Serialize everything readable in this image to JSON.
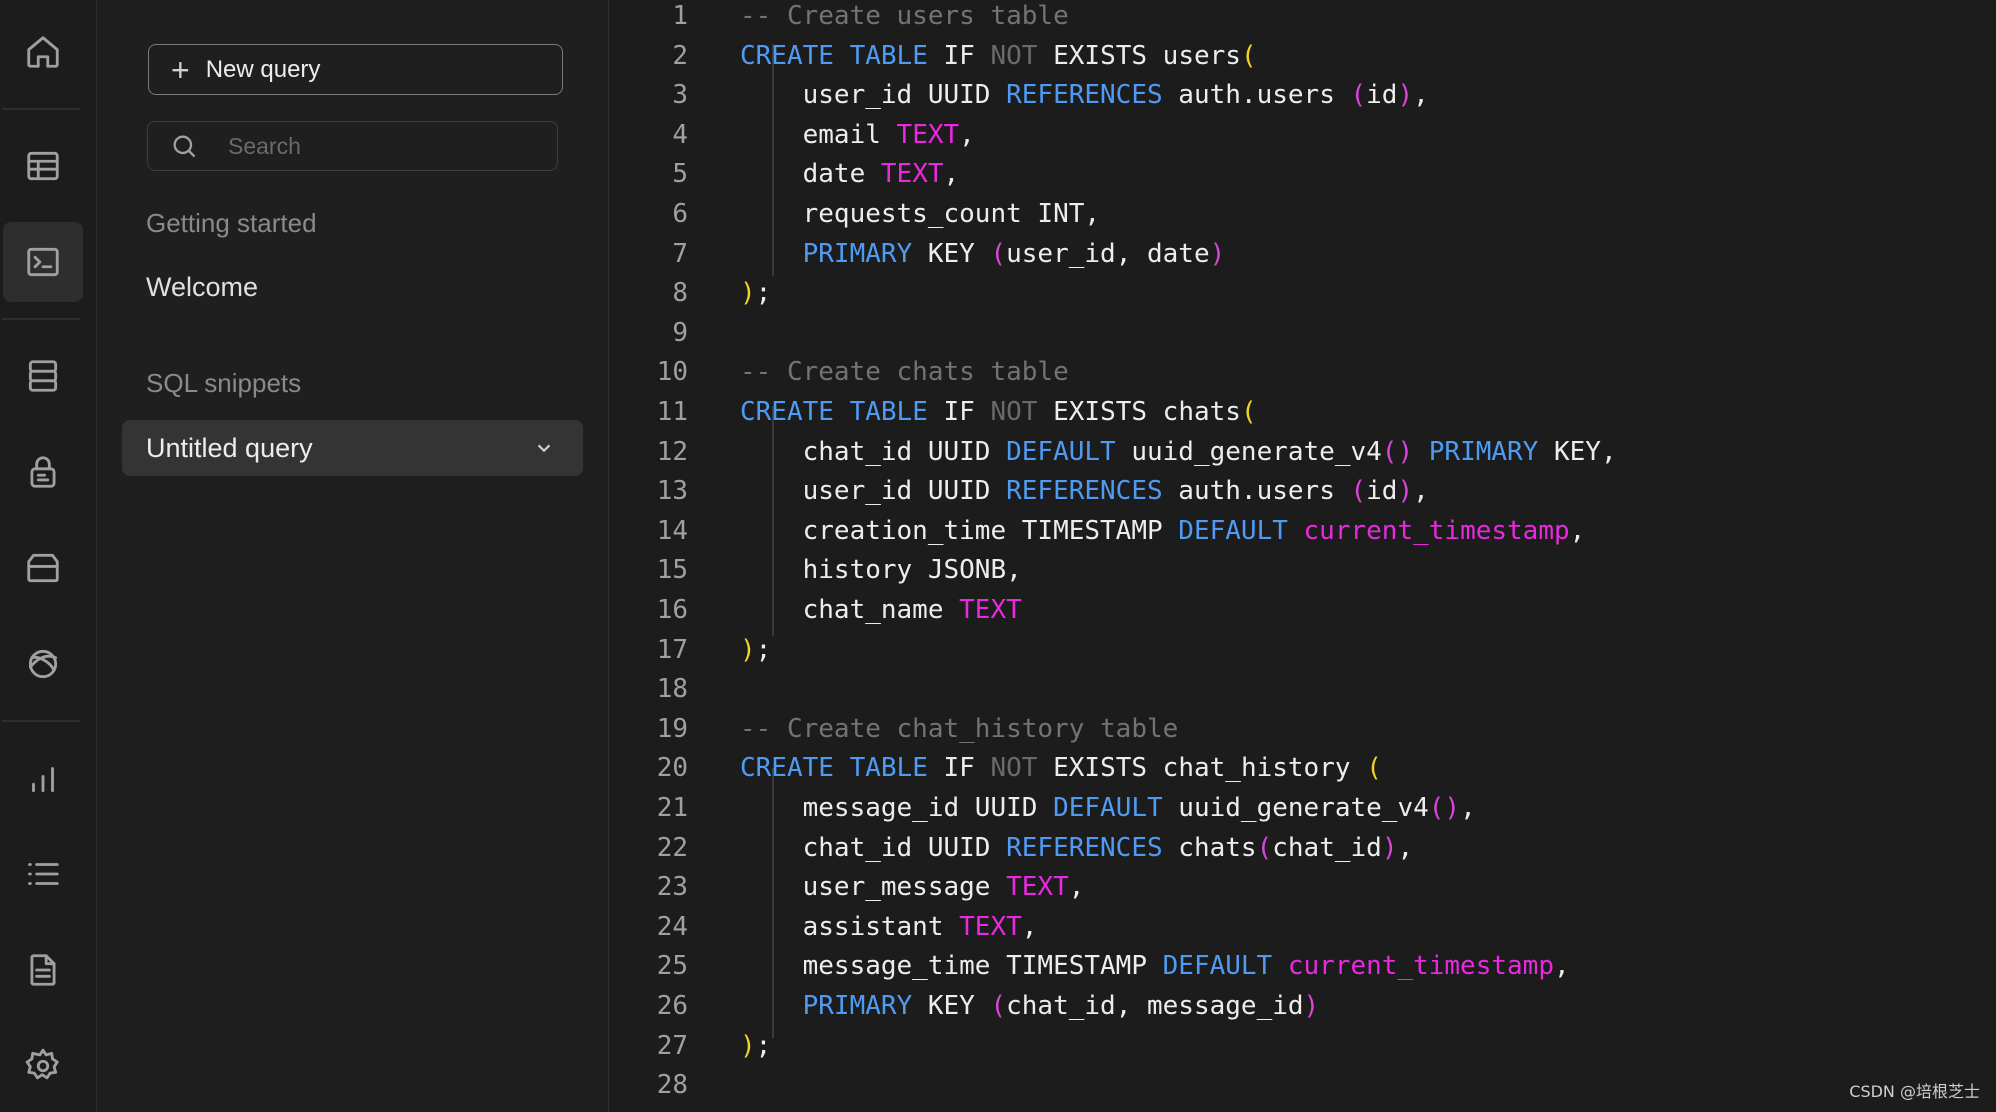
{
  "rail": {
    "items": [
      {
        "name": "home-icon"
      },
      {
        "name": "table-editor-icon"
      },
      {
        "name": "sql-editor-icon",
        "active": true
      },
      {
        "name": "database-icon"
      },
      {
        "name": "auth-lock-icon"
      },
      {
        "name": "storage-icon"
      },
      {
        "name": "realtime-icon"
      },
      {
        "name": "reports-icon"
      },
      {
        "name": "logs-icon"
      },
      {
        "name": "api-docs-icon"
      },
      {
        "name": "settings-icon"
      }
    ]
  },
  "sidebar": {
    "new_query_label": "New query",
    "search_placeholder": "Search",
    "getting_started_title": "Getting started",
    "welcome_label": "Welcome",
    "snippets_title": "SQL snippets",
    "untitled_label": "Untitled query"
  },
  "editor": {
    "lines": [
      [
        [
          "cm",
          "-- Create users table"
        ]
      ],
      [
        [
          "kw",
          "CREATE"
        ],
        [
          "",
          " "
        ],
        [
          "kw",
          "TABLE"
        ],
        [
          "",
          " IF "
        ],
        [
          "nt",
          "NOT"
        ],
        [
          "",
          " EXISTS users"
        ],
        [
          "br",
          "("
        ]
      ],
      [
        [
          "",
          "    user_id UUID "
        ],
        [
          "kw",
          "REFERENCES"
        ],
        [
          "",
          " auth.users "
        ],
        [
          "bp",
          "("
        ],
        [
          "",
          "id"
        ],
        [
          "bp",
          ")"
        ],
        [
          "",
          ","
        ]
      ],
      [
        [
          "",
          "    email "
        ],
        [
          "ty",
          "TEXT"
        ],
        [
          "",
          ","
        ]
      ],
      [
        [
          "",
          "    date "
        ],
        [
          "ty",
          "TEXT"
        ],
        [
          "",
          ","
        ]
      ],
      [
        [
          "",
          "    requests_count INT,"
        ]
      ],
      [
        [
          "kw",
          "    PRIMARY"
        ],
        [
          "",
          " KEY "
        ],
        [
          "bp",
          "("
        ],
        [
          "",
          "user_id, date"
        ],
        [
          "bp",
          ")"
        ]
      ],
      [
        [
          "br",
          ")"
        ],
        [
          "",
          ";"
        ]
      ],
      [],
      [
        [
          "cm",
          "-- Create chats table"
        ]
      ],
      [
        [
          "kw",
          "CREATE"
        ],
        [
          "",
          " "
        ],
        [
          "kw",
          "TABLE"
        ],
        [
          "",
          " IF "
        ],
        [
          "nt",
          "NOT"
        ],
        [
          "",
          " EXISTS chats"
        ],
        [
          "br",
          "("
        ]
      ],
      [
        [
          "",
          "    chat_id UUID "
        ],
        [
          "kw",
          "DEFAULT"
        ],
        [
          "",
          " uuid_generate_v4"
        ],
        [
          "bp",
          "()"
        ],
        [
          "",
          " "
        ],
        [
          "kw",
          "PRIMARY"
        ],
        [
          "",
          " KEY,"
        ]
      ],
      [
        [
          "",
          "    user_id UUID "
        ],
        [
          "kw",
          "REFERENCES"
        ],
        [
          "",
          " auth.users "
        ],
        [
          "bp",
          "("
        ],
        [
          "",
          "id"
        ],
        [
          "bp",
          ")"
        ],
        [
          "",
          ","
        ]
      ],
      [
        [
          "",
          "    creation_time TIMESTAMP "
        ],
        [
          "kw",
          "DEFAULT"
        ],
        [
          "",
          " "
        ],
        [
          "ty",
          "current_timestamp"
        ],
        [
          "",
          ","
        ]
      ],
      [
        [
          "",
          "    history JSONB,"
        ]
      ],
      [
        [
          "",
          "    chat_name "
        ],
        [
          "ty",
          "TEXT"
        ]
      ],
      [
        [
          "br",
          ")"
        ],
        [
          "",
          ";"
        ]
      ],
      [],
      [
        [
          "cm",
          "-- Create chat_history table"
        ]
      ],
      [
        [
          "kw",
          "CREATE"
        ],
        [
          "",
          " "
        ],
        [
          "kw",
          "TABLE"
        ],
        [
          "",
          " IF "
        ],
        [
          "nt",
          "NOT"
        ],
        [
          "",
          " EXISTS chat_history "
        ],
        [
          "br",
          "("
        ]
      ],
      [
        [
          "",
          "    message_id UUID "
        ],
        [
          "kw",
          "DEFAULT"
        ],
        [
          "",
          " uuid_generate_v4"
        ],
        [
          "bp",
          "()"
        ],
        [
          "",
          ","
        ]
      ],
      [
        [
          "",
          "    chat_id UUID "
        ],
        [
          "kw",
          "REFERENCES"
        ],
        [
          "",
          " chats"
        ],
        [
          "bp",
          "("
        ],
        [
          "",
          "chat_id"
        ],
        [
          "bp",
          ")"
        ],
        [
          "",
          ","
        ]
      ],
      [
        [
          "",
          "    user_message "
        ],
        [
          "ty",
          "TEXT"
        ],
        [
          "",
          ","
        ]
      ],
      [
        [
          "",
          "    assistant "
        ],
        [
          "ty",
          "TEXT"
        ],
        [
          "",
          ","
        ]
      ],
      [
        [
          "",
          "    message_time TIMESTAMP "
        ],
        [
          "kw",
          "DEFAULT"
        ],
        [
          "",
          " "
        ],
        [
          "ty",
          "current_timestamp"
        ],
        [
          "",
          ","
        ]
      ],
      [
        [
          "kw",
          "    PRIMARY"
        ],
        [
          "",
          " KEY "
        ],
        [
          "bp",
          "("
        ],
        [
          "",
          "chat_id, message_id"
        ],
        [
          "bp",
          ")"
        ]
      ],
      [
        [
          "br",
          ")"
        ],
        [
          "",
          ";"
        ]
      ],
      []
    ]
  },
  "watermark": "CSDN @培根芝士"
}
